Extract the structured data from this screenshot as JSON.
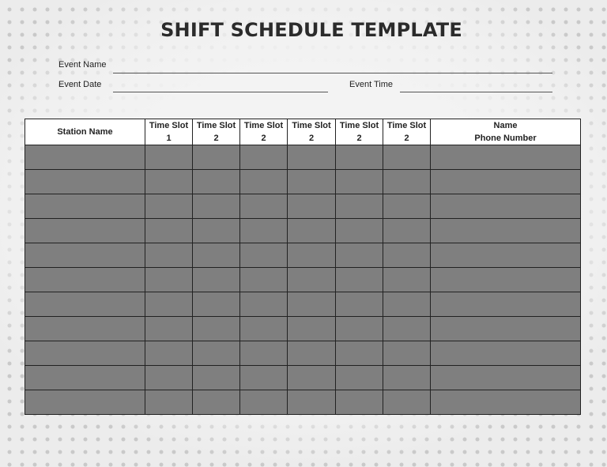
{
  "title": "SHIFT SCHEDULE TEMPLATE",
  "fields": {
    "event_name_label": "Event Name",
    "event_date_label": "Event Date",
    "event_time_label": "Event Time",
    "event_name_value": "",
    "event_date_value": "",
    "event_time_value": ""
  },
  "table": {
    "headers": [
      {
        "line1": "Station Name",
        "line2": ""
      },
      {
        "line1": "Time Slot",
        "line2": "1"
      },
      {
        "line1": "Time Slot",
        "line2": "2"
      },
      {
        "line1": "Time Slot",
        "line2": "2"
      },
      {
        "line1": "Time Slot",
        "line2": "2"
      },
      {
        "line1": "Time Slot",
        "line2": "2"
      },
      {
        "line1": "Time Slot",
        "line2": "2"
      },
      {
        "line1": "Name",
        "line2": "Phone Number"
      }
    ],
    "rows": [
      [
        "",
        "",
        "",
        "",
        "",
        "",
        "",
        ""
      ],
      [
        "",
        "",
        "",
        "",
        "",
        "",
        "",
        ""
      ],
      [
        "",
        "",
        "",
        "",
        "",
        "",
        "",
        ""
      ],
      [
        "",
        "",
        "",
        "",
        "",
        "",
        "",
        ""
      ],
      [
        "",
        "",
        "",
        "",
        "",
        "",
        "",
        ""
      ],
      [
        "",
        "",
        "",
        "",
        "",
        "",
        "",
        ""
      ],
      [
        "",
        "",
        "",
        "",
        "",
        "",
        "",
        ""
      ],
      [
        "",
        "",
        "",
        "",
        "",
        "",
        "",
        ""
      ],
      [
        "",
        "",
        "",
        "",
        "",
        "",
        "",
        ""
      ],
      [
        "",
        "",
        "",
        "",
        "",
        "",
        "",
        ""
      ],
      [
        "",
        "",
        "",
        "",
        "",
        "",
        "",
        ""
      ]
    ]
  }
}
